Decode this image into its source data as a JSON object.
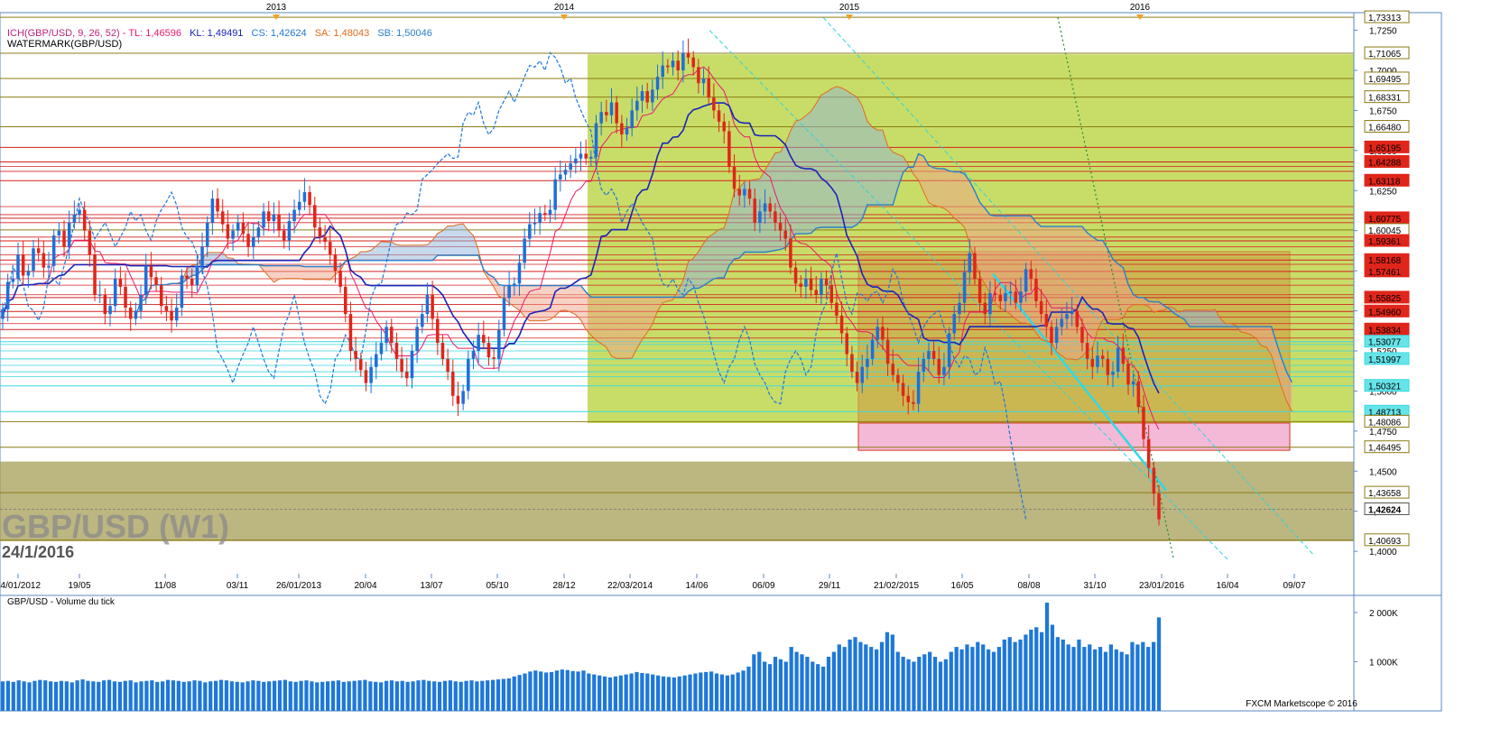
{
  "header": {
    "indicator_line": {
      "name": "ICH(GBP/USD, 9, 26, 52)",
      "tl": "TL: 1,46596",
      "kl": "KL: 1,49491",
      "cs": "CS: 1,42624",
      "sa": "SA: 1,48043",
      "sb": "SB: 1,50046"
    },
    "watermark_label": "WATERMARK(GBP/USD)"
  },
  "watermark": {
    "symbol": "GBP/USD (W1)",
    "date": "24/1/2016"
  },
  "volume_title": "GBP/USD - Volume du tick",
  "footer_credit": "FXCM Marketscope © 2016",
  "colors": {
    "bull": "#1e6fd9",
    "bear": "#e0251a",
    "tenkan": "#e8196e",
    "kijun": "#1a24b8",
    "chikou": "#1e78d8",
    "senkou_a": "#e06c1c",
    "senkou_b": "#2a7fc9",
    "box_green": "#b5d234",
    "box_orange": "#d08a3a",
    "box_pink": "#f5b9d8",
    "band_olive": "#a59d55",
    "line_red": "#d42020",
    "line_olive": "#8c7b14",
    "line_cyan": "#3ad8e0",
    "volume_bar": "#1e78d8"
  },
  "chart_data": [
    {
      "type": "candlestick",
      "title": "GBP/USD (W1)",
      "x_ticks": [
        "14/01/2012",
        "19/05",
        "11/08",
        "03/11",
        "26/01/2013",
        "20/04",
        "13/07",
        "05/10",
        "28/12",
        "22/03/2014",
        "14/06",
        "06/09",
        "29/11",
        "21/02/2015",
        "16/05",
        "08/08",
        "31/10",
        "23/01/2016",
        "16/04",
        "09/07"
      ],
      "year_markers": [
        "2013",
        "2014",
        "2015",
        "2016"
      ],
      "y_ticks": [
        1.4,
        1.425,
        1.45,
        1.475,
        1.5,
        1.525,
        1.55,
        1.575,
        1.6,
        1.625,
        1.65,
        1.675,
        1.7,
        1.725
      ],
      "ylim": [
        1.386,
        1.736
      ],
      "price_labels": [
        {
          "value": 1.73313,
          "text": "1,73313",
          "style": "olive"
        },
        {
          "value": 1.71065,
          "text": "1,71065",
          "style": "olive"
        },
        {
          "value": 1.69495,
          "text": "1,69495",
          "style": "olive"
        },
        {
          "value": 1.68331,
          "text": "1,68331",
          "style": "olive"
        },
        {
          "value": 1.6648,
          "text": "1,66480",
          "style": "olive"
        },
        {
          "value": 1.65195,
          "text": "1,65195",
          "style": "red"
        },
        {
          "value": 1.64288,
          "text": "1,64288",
          "style": "red"
        },
        {
          "value": 1.63118,
          "text": "1,63118",
          "style": "red"
        },
        {
          "value": 1.60775,
          "text": "1,60775",
          "style": "red"
        },
        {
          "value": 1.60045,
          "text": "1,60045",
          "style": "olive"
        },
        {
          "value": 1.59361,
          "text": "1,59361",
          "style": "red"
        },
        {
          "value": 1.58168,
          "text": "1,58168",
          "style": "red"
        },
        {
          "value": 1.57461,
          "text": "1,57461",
          "style": "red"
        },
        {
          "value": 1.55825,
          "text": "1,55825",
          "style": "red"
        },
        {
          "value": 1.5496,
          "text": "1,54960",
          "style": "red"
        },
        {
          "value": 1.53834,
          "text": "1,53834",
          "style": "red"
        },
        {
          "value": 1.53077,
          "text": "1,53077",
          "style": "cyan"
        },
        {
          "value": 1.51997,
          "text": "1,51997",
          "style": "cyan"
        },
        {
          "value": 1.50321,
          "text": "1,50321",
          "style": "cyan"
        },
        {
          "value": 1.48713,
          "text": "1,48713",
          "style": "cyan"
        },
        {
          "value": 1.48086,
          "text": "1,48086",
          "style": "olive"
        },
        {
          "value": 1.46495,
          "text": "1,46495",
          "style": "olive"
        },
        {
          "value": 1.43658,
          "text": "1,43658",
          "style": "olive"
        },
        {
          "value": 1.42624,
          "text": "1,42624",
          "style": "current"
        },
        {
          "value": 1.40693,
          "text": "1,40693",
          "style": "olive"
        }
      ],
      "indicator": {
        "name": "ICH(GBP/USD, 9, 26, 52)",
        "tenkan": 1.46596,
        "kijun": 1.49491,
        "chikou": 1.42624,
        "senkou_a": 1.48043,
        "senkou_b": 1.50046
      },
      "ohlc_closes": [
        1.551,
        1.568,
        1.57,
        1.585,
        1.572,
        1.575,
        1.589,
        1.586,
        1.577,
        1.578,
        1.597,
        1.6,
        1.59,
        1.605,
        1.61,
        1.613,
        1.6,
        1.585,
        1.56,
        1.56,
        1.548,
        1.553,
        1.57,
        1.565,
        1.552,
        1.545,
        1.55,
        1.56,
        1.578,
        1.571,
        1.566,
        1.553,
        1.55,
        1.544,
        1.552,
        1.572,
        1.57,
        1.566,
        1.578,
        1.59,
        1.605,
        1.62,
        1.612,
        1.604,
        1.595,
        1.6,
        1.605,
        1.598,
        1.59,
        1.596,
        1.602,
        1.612,
        1.606,
        1.61,
        1.6,
        1.594,
        1.606,
        1.613,
        1.618,
        1.624,
        1.616,
        1.602,
        1.596,
        1.593,
        1.585,
        1.575,
        1.565,
        1.548,
        1.525,
        1.52,
        1.513,
        1.505,
        1.515,
        1.523,
        1.53,
        1.54,
        1.53,
        1.52,
        1.512,
        1.508,
        1.525,
        1.54,
        1.548,
        1.56,
        1.545,
        1.53,
        1.52,
        1.512,
        1.497,
        1.492,
        1.5,
        1.52,
        1.525,
        1.535,
        1.53,
        1.521,
        1.52,
        1.538,
        1.558,
        1.566,
        1.567,
        1.58,
        1.595,
        1.604,
        1.605,
        1.611,
        1.61,
        1.613,
        1.632,
        1.635,
        1.638,
        1.642,
        1.645,
        1.648,
        1.645,
        1.646,
        1.667,
        1.674,
        1.672,
        1.68,
        1.667,
        1.66,
        1.664,
        1.675,
        1.681,
        1.687,
        1.68,
        1.688,
        1.696,
        1.703,
        1.702,
        1.706,
        1.7,
        1.711,
        1.708,
        1.702,
        1.692,
        1.695,
        1.683,
        1.675,
        1.668,
        1.662,
        1.64,
        1.626,
        1.622,
        1.626,
        1.62,
        1.605,
        1.612,
        1.617,
        1.612,
        1.605,
        1.6,
        1.595,
        1.577,
        1.567,
        1.565,
        1.57,
        1.563,
        1.56,
        1.57,
        1.566,
        1.555,
        1.547,
        1.536,
        1.523,
        1.512,
        1.505,
        1.515,
        1.52,
        1.532,
        1.54,
        1.532,
        1.517,
        1.51,
        1.505,
        1.497,
        1.493,
        1.492,
        1.512,
        1.52,
        1.525,
        1.52,
        1.51,
        1.515,
        1.536,
        1.548,
        1.555,
        1.574,
        1.586,
        1.57,
        1.555,
        1.548,
        1.561,
        1.56,
        1.556,
        1.561,
        1.562,
        1.555,
        1.562,
        1.576,
        1.57,
        1.556,
        1.548,
        1.54,
        1.53,
        1.54,
        1.545,
        1.548,
        1.55,
        1.54,
        1.53,
        1.52,
        1.515,
        1.522,
        1.52,
        1.51,
        1.512,
        1.527,
        1.517,
        1.504,
        1.506,
        1.49,
        1.47,
        1.452,
        1.436,
        1.42
      ]
    },
    {
      "type": "bar",
      "title": "GBP/USD - Volume du tick",
      "y_ticks": [
        {
          "value": 1000000,
          "text": "1 000K"
        },
        {
          "value": 2000000,
          "text": "2 000K"
        }
      ],
      "ylim": [
        0,
        2200000
      ],
      "values": [
        600000,
        610000,
        590000,
        620000,
        600000,
        580000,
        610000,
        630000,
        620000,
        600000,
        590000,
        610000,
        600000,
        580000,
        620000,
        640000,
        610000,
        600000,
        590000,
        620000,
        630000,
        600000,
        590000,
        610000,
        620000,
        580000,
        600000,
        610000,
        620000,
        590000,
        600000,
        630000,
        620000,
        610000,
        590000,
        600000,
        620000,
        610000,
        580000,
        600000,
        610000,
        630000,
        620000,
        600000,
        590000,
        580000,
        600000,
        620000,
        610000,
        590000,
        600000,
        610000,
        620000,
        630000,
        600000,
        590000,
        610000,
        620000,
        600000,
        580000,
        590000,
        600000,
        610000,
        620000,
        590000,
        600000,
        610000,
        620000,
        630000,
        600000,
        590000,
        580000,
        610000,
        620000,
        600000,
        610000,
        590000,
        600000,
        620000,
        630000,
        610000,
        600000,
        590000,
        610000,
        620000,
        600000,
        590000,
        610000,
        620000,
        600000,
        610000,
        620000,
        630000,
        640000,
        650000,
        660000,
        700000,
        730000,
        760000,
        800000,
        820000,
        800000,
        780000,
        790000,
        820000,
        840000,
        830000,
        810000,
        800000,
        820000,
        760000,
        740000,
        720000,
        700000,
        680000,
        700000,
        720000,
        740000,
        760000,
        790000,
        770000,
        760000,
        740000,
        720000,
        700000,
        690000,
        680000,
        700000,
        720000,
        740000,
        760000,
        780000,
        790000,
        800000,
        760000,
        740000,
        720000,
        740000,
        780000,
        820000,
        900000,
        1150000,
        1200000,
        1000000,
        950000,
        1100000,
        1050000,
        1000000,
        1300000,
        1200000,
        1150000,
        1100000,
        1000000,
        950000,
        900000,
        1100000,
        1200000,
        1350000,
        1300000,
        1450000,
        1500000,
        1400000,
        1350000,
        1300000,
        1250000,
        1400000,
        1600000,
        1550000,
        1200000,
        1100000,
        1050000,
        1000000,
        1100000,
        1150000,
        1200000,
        1100000,
        1000000,
        1050000,
        1200000,
        1300000,
        1250000,
        1350000,
        1300000,
        1400000,
        1350000,
        1250000,
        1200000,
        1300000,
        1450000,
        1500000,
        1400000,
        1450000,
        1550000,
        1650000,
        1700000,
        1600000,
        2200000,
        1750000,
        1500000,
        1450000,
        1350000,
        1300000,
        1450000,
        1300000,
        1350000,
        1250000,
        1300000,
        1200000,
        1350000,
        1250000,
        1200000,
        1150000,
        1400000,
        1350000,
        1400000,
        1300000,
        1400000,
        1900000
      ]
    }
  ]
}
